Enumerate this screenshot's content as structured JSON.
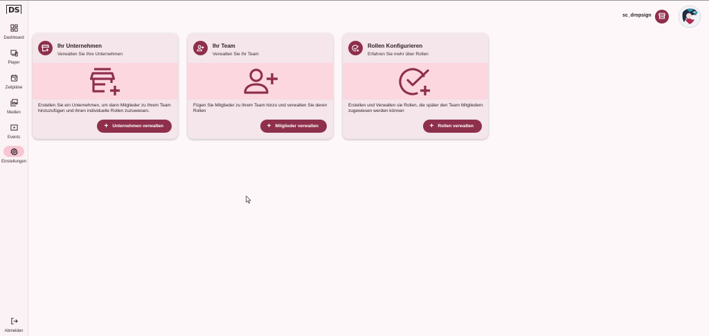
{
  "app": {
    "logo_text": "DS"
  },
  "sidebar": {
    "items": [
      {
        "label": "Dashboard",
        "icon": "dashboard-icon",
        "active": false
      },
      {
        "label": "Player",
        "icon": "devices-icon",
        "active": false
      },
      {
        "label": "Zeitpläne",
        "icon": "calendar-icon",
        "active": false
      },
      {
        "label": "Medien",
        "icon": "media-library-icon",
        "active": false
      },
      {
        "label": "Events",
        "icon": "play-box-icon",
        "active": false
      },
      {
        "label": "Einstellungen",
        "icon": "gear-icon",
        "active": true
      }
    ],
    "logout_label": "Abmelden"
  },
  "header": {
    "username": "sc_dropsign",
    "company_icon": "storefront-icon"
  },
  "cards": [
    {
      "title": "Ihr Unternehmen",
      "subtitle": "Verwalten Sie Ihre Unternehmen",
      "icon": "add-business-icon",
      "description": "Erstellen Sie ein Unternehmen, um dann Mitglieder zu Ihrem Team hinzuzufügen und ihnen individuelle Rollen zuzuweisen.",
      "action_label": "Unternehmen verwalten"
    },
    {
      "title": "Ihr Team",
      "subtitle": "Verwalten Sie Ihr Team",
      "icon": "person-add-icon",
      "description": "Fügen Sie Mitglieder zu ihrem Team hinzu und verwalten Sie deren Rollen",
      "action_label": "Mitglieder verwalten"
    },
    {
      "title": "Rollen Konfigurieren",
      "subtitle": "Erfahren Sie mehr über Rollen",
      "icon": "check-circle-add-icon",
      "description": "Erstellen und Verwalten sie Rollen, die später den Team Mitgliedern zugewiesen werden können",
      "action_label": "Rollen verwalten"
    }
  ],
  "colors": {
    "primary": "#8e2f4c",
    "card_bg": "#f4e6ea",
    "media_bg": "#fcd7e0",
    "page_bg": "#fdf7f9",
    "active_nav_bg": "#f7c6d2"
  }
}
